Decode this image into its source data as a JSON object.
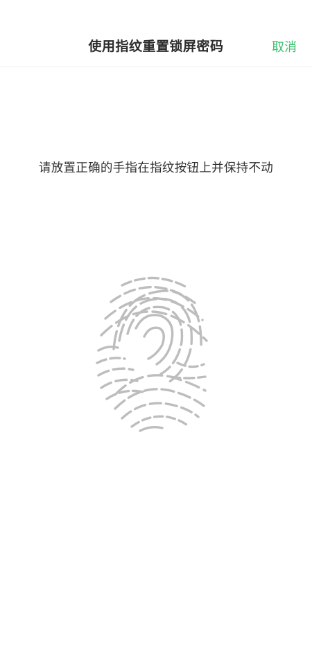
{
  "header": {
    "title": "使用指纹重置锁屏密码",
    "cancel_label": "取消"
  },
  "main": {
    "prompt": "请放置正确的手指在指纹按钮上并保持不动"
  },
  "icons": {
    "fingerprint": "fingerprint-icon"
  },
  "colors": {
    "accent": "#3cbf6f",
    "fingerprint": "#bdbdbd"
  }
}
